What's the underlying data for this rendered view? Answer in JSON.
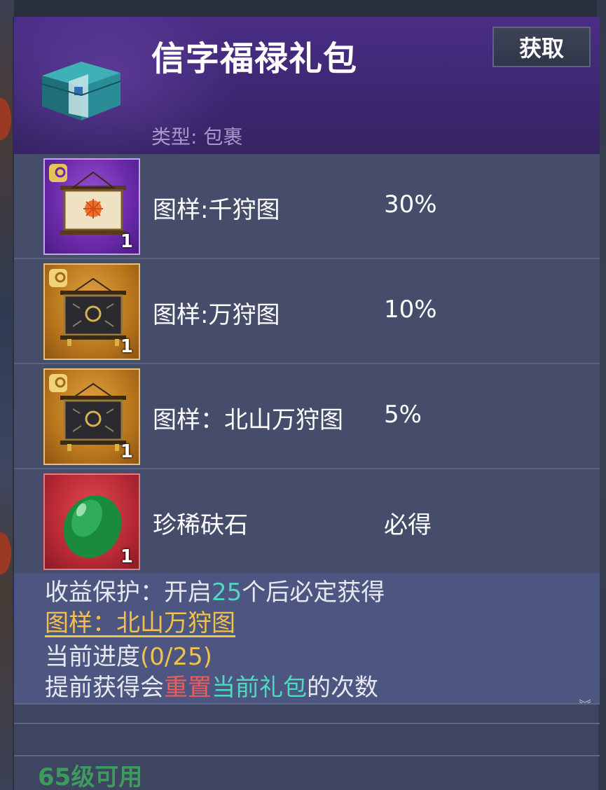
{
  "package": {
    "title": "信字福禄礼包",
    "type_label": "类型: 包裹",
    "get_button": "获取"
  },
  "items": [
    {
      "name": "图样:千狩图",
      "chance": "30%",
      "quantity": "1",
      "rarity": "purple",
      "icon": "scroll-painting-icon"
    },
    {
      "name": "图样:万狩图",
      "chance": "10%",
      "quantity": "1",
      "rarity": "gold",
      "icon": "scroll-painting-icon"
    },
    {
      "name": "图样：北山万狩图",
      "chance": "5%",
      "quantity": "1",
      "rarity": "gold",
      "icon": "scroll-painting-icon"
    },
    {
      "name": "珍稀砆石",
      "chance": "必得",
      "quantity": "1",
      "rarity": "red",
      "icon": "green-stone-icon"
    }
  ],
  "protection": {
    "line1_prefix": "收益保护：开启",
    "line1_count": "25",
    "line1_suffix": "个后必定获得",
    "guaranteed_item": "图样：北山万狩图",
    "progress_label": "当前进度",
    "progress_value": "(0/25)",
    "progress": {
      "current": 0,
      "total": 25
    },
    "line4_prefix": "提前获得会",
    "line4_reset": "重置",
    "line4_pack": "当前礼包",
    "line4_suffix": "的次数"
  },
  "footer": {
    "level_requirement": "65级可用"
  },
  "colors": {
    "header_purple": "#3e2772",
    "highlight_green": "#4fd8c0",
    "highlight_red": "#f05a5a",
    "highlight_gold": "#f2c14a",
    "level_green": "#3f9a5e"
  }
}
